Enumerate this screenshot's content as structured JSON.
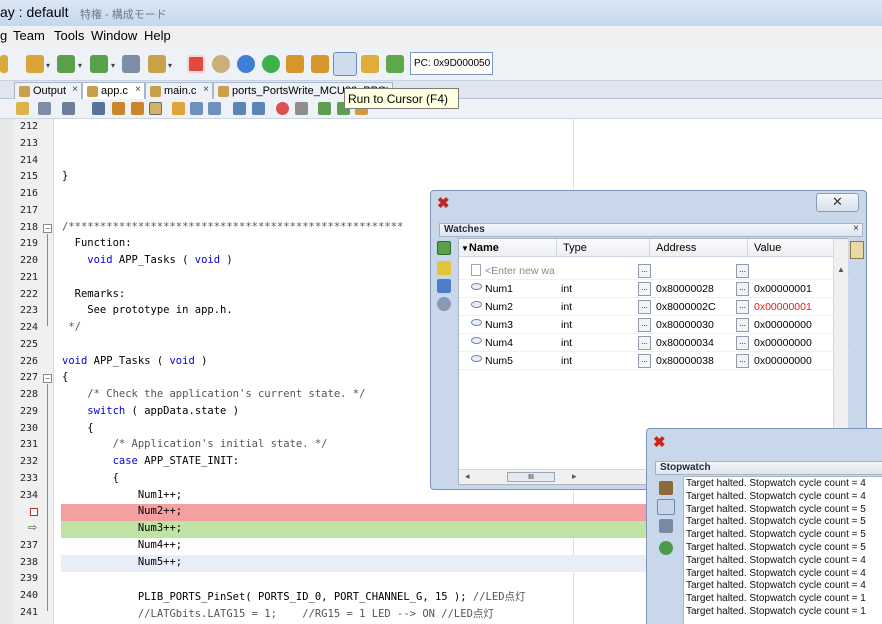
{
  "window": {
    "title": "ay : default",
    "title_suffix": "特権 - 構成モード"
  },
  "menu": [
    "g",
    "Team",
    "Tools",
    "Window",
    "Help"
  ],
  "toolbar": {
    "pc_label": "PC: 0x9D000050",
    "tooltip": "Run to Cursor (F4)"
  },
  "tabs": [
    {
      "label": "Output"
    },
    {
      "label": "app.c"
    },
    {
      "label": "main.c"
    },
    {
      "label": "ports_PortsWrite_MCU32_PPS.c"
    }
  ],
  "code_lines": [
    {
      "num": "212",
      "text": ""
    },
    {
      "num": "213",
      "text": ""
    },
    {
      "num": "214",
      "text": ""
    },
    {
      "num": "215",
      "text": "}"
    },
    {
      "num": "216",
      "text": ""
    },
    {
      "num": "217",
      "text": ""
    },
    {
      "num": "218",
      "text": "/*****************************************************"
    },
    {
      "num": "219",
      "text": "  Function:"
    },
    {
      "num": "220",
      "text": "    void APP_Tasks ( void )"
    },
    {
      "num": "221",
      "text": ""
    },
    {
      "num": "222",
      "text": "  Remarks:"
    },
    {
      "num": "223",
      "text": "    See prototype in app.h."
    },
    {
      "num": "224",
      "text": " */"
    },
    {
      "num": "225",
      "text": ""
    },
    {
      "num": "226",
      "text": "void APP_Tasks ( void )"
    },
    {
      "num": "227",
      "text": "{"
    },
    {
      "num": "228",
      "text": "    /* Check the application's current state. */"
    },
    {
      "num": "229",
      "text": "    switch ( appData.state )"
    },
    {
      "num": "230",
      "text": "    {"
    },
    {
      "num": "231",
      "text": "        /* Application's initial state. */"
    },
    {
      "num": "232",
      "text": "        case APP_STATE_INIT:"
    },
    {
      "num": "233",
      "text": "        {"
    },
    {
      "num": "234",
      "text": "            Num1++;"
    },
    {
      "num": "",
      "text": "            Num2++;"
    },
    {
      "num": "",
      "text": "            Num3++;"
    },
    {
      "num": "237",
      "text": "            Num4++;"
    },
    {
      "num": "238",
      "text": "            Num5++;"
    },
    {
      "num": "239",
      "text": ""
    },
    {
      "num": "240",
      "text": "            PLIB_PORTS_PinSet( PORTS_ID_0, PORT_CHANNEL_G, 15 ); //LED点灯"
    },
    {
      "num": "241",
      "text": "            //LATGbits.LATG15 = 1;    //RG15 = 1 LED --> ON //LED点灯"
    }
  ],
  "watches": {
    "title": "Watches",
    "columns": {
      "name": "Name",
      "type": "Type",
      "address": "Address",
      "value": "Value"
    },
    "new_watch_placeholder": "<Enter new wa",
    "rows": [
      {
        "name": "Num1",
        "type": "int",
        "address": "0x80000028",
        "value": "0x00000001",
        "changed": false
      },
      {
        "name": "Num2",
        "type": "int",
        "address": "0x8000002C",
        "value": "0x00000001",
        "changed": true
      },
      {
        "name": "Num3",
        "type": "int",
        "address": "0x80000030",
        "value": "0x00000000",
        "changed": false
      },
      {
        "name": "Num4",
        "type": "int",
        "address": "0x80000034",
        "value": "0x00000000",
        "changed": false
      },
      {
        "name": "Num5",
        "type": "int",
        "address": "0x80000038",
        "value": "0x00000000",
        "changed": false
      }
    ],
    "scroll_thumb": "III"
  },
  "stopwatch": {
    "title": "Stopwatch",
    "lines": [
      "Target halted. Stopwatch cycle count = 4",
      "Target halted. Stopwatch cycle count = 4",
      "Target halted. Stopwatch cycle count = 5",
      "Target halted. Stopwatch cycle count = 5",
      "Target halted. Stopwatch cycle count = 5",
      "Target halted. Stopwatch cycle count = 5",
      "Target halted. Stopwatch cycle count = 4",
      "Target halted. Stopwatch cycle count = 4",
      "Target halted. Stopwatch cycle count = 4",
      "Target halted. Stopwatch cycle count = 1",
      "Target halted. Stopwatch cycle count = 1"
    ]
  },
  "colors": {
    "breakpoint_line": "#f5a0a0",
    "pc_line": "#bfe3a4",
    "cursor_line": "#e8eef8",
    "changed_value": "#e0201a"
  }
}
